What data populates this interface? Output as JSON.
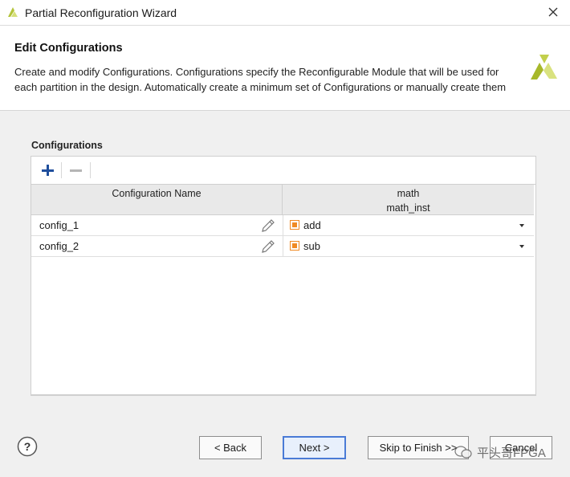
{
  "window": {
    "title": "Partial Reconfiguration Wizard"
  },
  "header": {
    "title": "Edit Configurations",
    "description": "Create and modify Configurations. Configurations specify the Reconfigurable Module that will be used for each partition in the design. Automatically create a minimum set of Configurations or manually create them"
  },
  "section_label": "Configurations",
  "table": {
    "columns": [
      {
        "line1": "Configuration Name",
        "line2": ""
      },
      {
        "line1": "math",
        "line2": "math_inst"
      }
    ],
    "rows": [
      {
        "name": "config_1",
        "module": "add"
      },
      {
        "name": "config_2",
        "module": "sub"
      }
    ]
  },
  "buttons": {
    "back": "< Back",
    "next": "Next >",
    "skip": "Skip to Finish >>",
    "cancel": "Cancel"
  },
  "help": "?",
  "watermark": "平头哥FPGA",
  "colors": {
    "accent": "#4a7bd6",
    "brand_logo": "#b3c43a",
    "module_icon": "#f08a24",
    "add": "#1f4e9c"
  }
}
